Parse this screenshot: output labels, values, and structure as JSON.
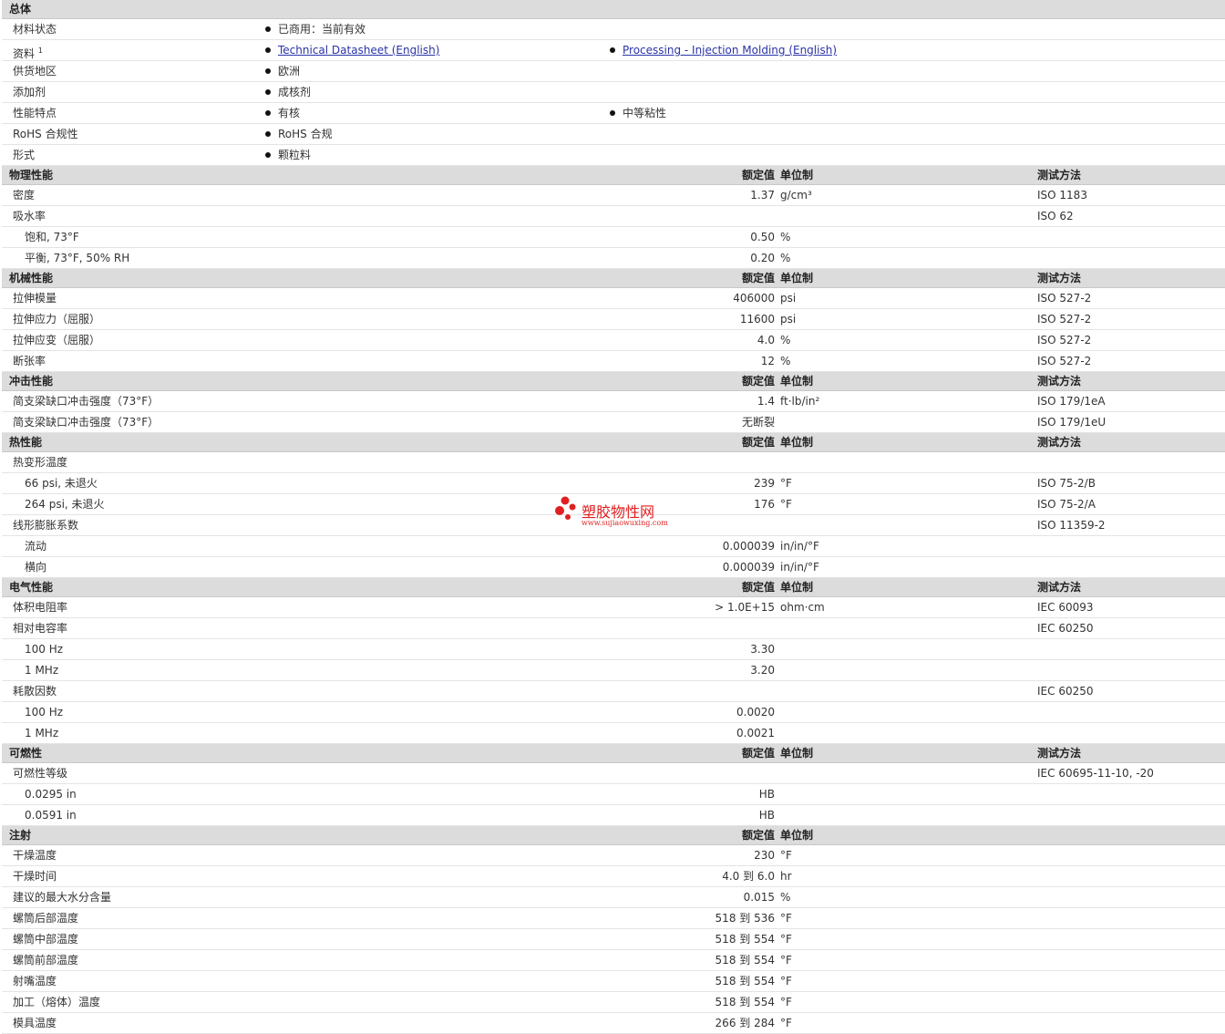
{
  "general": {
    "title": "总体",
    "rows": [
      {
        "name": "材料状态",
        "b1": "已商用：当前有效",
        "b2": ""
      },
      {
        "name": "资料",
        "sup": "1",
        "b1": "Technical Datasheet (English)",
        "b2": "Processing - Injection Molding (English)",
        "link": true
      },
      {
        "name": "供货地区",
        "b1": "欧洲",
        "b2": ""
      },
      {
        "name": "添加剂",
        "b1": "成核剂",
        "b2": ""
      },
      {
        "name": "性能特点",
        "b1": "有核",
        "b2": "中等粘性"
      },
      {
        "name": "RoHS 合规性",
        "b1": "RoHS 合规",
        "b2": ""
      },
      {
        "name": "形式",
        "b1": "颗粒料",
        "b2": ""
      }
    ]
  },
  "header_labels": {
    "value": "额定值",
    "unit": "单位制",
    "test": "测试方法"
  },
  "sections": [
    {
      "title": "物理性能",
      "show_test": true,
      "rows": [
        {
          "name": "密度",
          "value": "1.37",
          "unit": "g/cm³",
          "test": "ISO 1183"
        },
        {
          "name": "吸水率",
          "value": "",
          "unit": "",
          "test": "ISO 62"
        },
        {
          "name": "饱和, 73°F",
          "sub": true,
          "value": "0.50",
          "unit": "%",
          "test": ""
        },
        {
          "name": "平衡, 73°F, 50% RH",
          "sub": true,
          "value": "0.20",
          "unit": "%",
          "test": ""
        }
      ]
    },
    {
      "title": "机械性能",
      "show_test": true,
      "rows": [
        {
          "name": "拉伸模量",
          "value": "406000",
          "unit": "psi",
          "test": "ISO 527-2"
        },
        {
          "name": "拉伸应力（屈服）",
          "value": "11600",
          "unit": "psi",
          "test": "ISO 527-2"
        },
        {
          "name": "拉伸应变（屈服）",
          "value": "4.0",
          "unit": "%",
          "test": "ISO 527-2"
        },
        {
          "name": "断张率",
          "value": "12",
          "unit": "%",
          "test": "ISO 527-2"
        }
      ]
    },
    {
      "title": "冲击性能",
      "show_test": true,
      "rows": [
        {
          "name": "简支梁缺口冲击强度（73°F）",
          "value": "1.4",
          "unit": "ft·lb/in²",
          "test": "ISO 179/1eA"
        },
        {
          "name": "简支梁缺口冲击强度（73°F）",
          "value": "无断裂",
          "unit": "",
          "test": "ISO 179/1eU"
        }
      ]
    },
    {
      "title": "热性能",
      "show_test": true,
      "rows": [
        {
          "name": "热变形温度",
          "value": "",
          "unit": "",
          "test": ""
        },
        {
          "name": "66 psi, 未退火",
          "sub": true,
          "value": "239",
          "unit": "°F",
          "test": "ISO 75-2/B"
        },
        {
          "name": "264 psi, 未退火",
          "sub": true,
          "value": "176",
          "unit": "°F",
          "test": "ISO 75-2/A"
        },
        {
          "name": "线形膨胀系数",
          "value": "",
          "unit": "",
          "test": "ISO 11359-2"
        },
        {
          "name": "流动",
          "sub": true,
          "value": "0.000039",
          "unit": "in/in/°F",
          "test": ""
        },
        {
          "name": "横向",
          "sub": true,
          "value": "0.000039",
          "unit": "in/in/°F",
          "test": ""
        }
      ]
    },
    {
      "title": "电气性能",
      "show_test": true,
      "rows": [
        {
          "name": "体积电阻率",
          "value": "> 1.0E+15",
          "unit": "ohm·cm",
          "test": "IEC 60093"
        },
        {
          "name": "相对电容率",
          "value": "",
          "unit": "",
          "test": "IEC 60250"
        },
        {
          "name": "100 Hz",
          "sub": true,
          "value": "3.30",
          "unit": "",
          "test": ""
        },
        {
          "name": "1 MHz",
          "sub": true,
          "value": "3.20",
          "unit": "",
          "test": ""
        },
        {
          "name": "耗散因数",
          "value": "",
          "unit": "",
          "test": "IEC 60250"
        },
        {
          "name": "100 Hz",
          "sub": true,
          "value": "0.0020",
          "unit": "",
          "test": ""
        },
        {
          "name": "1 MHz",
          "sub": true,
          "value": "0.0021",
          "unit": "",
          "test": ""
        }
      ]
    },
    {
      "title": "可燃性",
      "show_test": true,
      "rows": [
        {
          "name": "可燃性等级",
          "value": "",
          "unit": "",
          "test": "IEC 60695-11-10, -20"
        },
        {
          "name": "0.0295 in",
          "sub": true,
          "value": "HB",
          "unit": "",
          "test": ""
        },
        {
          "name": "0.0591 in",
          "sub": true,
          "value": "HB",
          "unit": "",
          "test": ""
        }
      ]
    },
    {
      "title": "注射",
      "show_test": false,
      "rows": [
        {
          "name": "干燥温度",
          "value": "230",
          "unit": "°F",
          "test": ""
        },
        {
          "name": "干燥时间",
          "value": "4.0 到  6.0",
          "unit": "hr",
          "test": ""
        },
        {
          "name": "建议的最大水分含量",
          "value": "0.015",
          "unit": "%",
          "test": ""
        },
        {
          "name": "螺筒后部温度",
          "value": "518 到  536",
          "unit": "°F",
          "test": ""
        },
        {
          "name": "螺筒中部温度",
          "value": "518 到  554",
          "unit": "°F",
          "test": ""
        },
        {
          "name": "螺筒前部温度",
          "value": "518 到  554",
          "unit": "°F",
          "test": ""
        },
        {
          "name": "射嘴温度",
          "value": "518 到  554",
          "unit": "°F",
          "test": ""
        },
        {
          "name": "加工（熔体）温度",
          "value": "518 到  554",
          "unit": "°F",
          "test": ""
        },
        {
          "name": "模具温度",
          "value": "266 到  284",
          "unit": "°F",
          "test": ""
        }
      ]
    }
  ],
  "watermark": {
    "title": "塑胶物性网",
    "url": "www.sujiaowuxing.com"
  }
}
